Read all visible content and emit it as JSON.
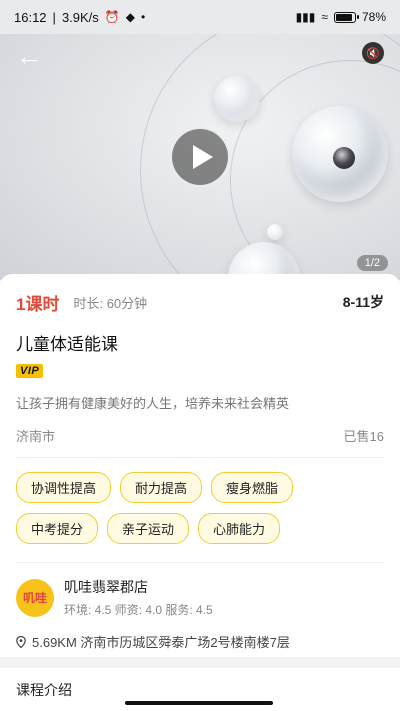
{
  "status_bar": {
    "time": "16:12",
    "speed": "3.9K/s",
    "battery": "78%"
  },
  "media": {
    "page_indicator": "1/2"
  },
  "course": {
    "lessons": "1课时",
    "duration": "时长: 60分钟",
    "age": "8-11岁",
    "title": "儿童体适能课",
    "vip_label": "VIP",
    "description": "让孩子拥有健康美好的人生，培养未来社会精英",
    "city": "济南市",
    "sold": "已售16"
  },
  "tags": [
    "协调性提高",
    "耐力提高",
    "瘦身燃脂",
    "中考提分",
    "亲子运动",
    "心肺能力"
  ],
  "store": {
    "logo_text": "叽哇",
    "name": "叽哇翡翠郡店",
    "rating": "环境: 4.5  师资: 4.0  服务: 4.5",
    "address": "5.69KM  济南市历城区舜泰广场2号楼南楼7层"
  },
  "section": {
    "title": "课程介绍"
  },
  "colors": {
    "accent": "#e14b3b",
    "tag_border": "#f2cd37",
    "vip": "#f6c000"
  }
}
